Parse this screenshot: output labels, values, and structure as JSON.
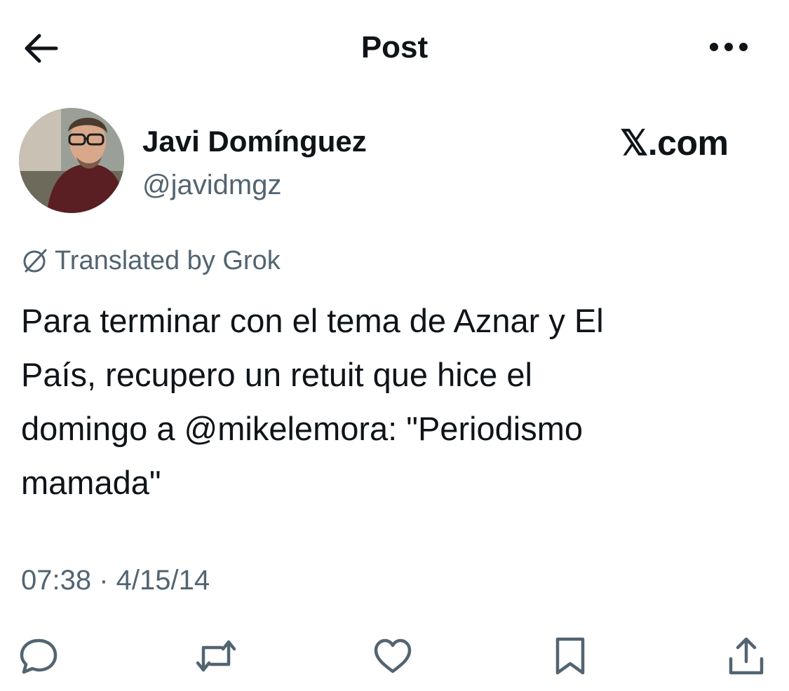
{
  "header": {
    "title": "Post",
    "back_icon": "back-arrow-icon",
    "more_icon": "more-icon"
  },
  "author": {
    "display_name": "Javi Domínguez",
    "handle": "@javidmgz",
    "avatar": "avatar-photo"
  },
  "watermark": "𝕏.com",
  "translation_note": "Translated by Grok",
  "post": {
    "lines": [
      "Para terminar con el tema de Aznar y El",
      "País, recupero un retuit que hice el",
      "domingo a @mikelemora: \"Periodismo",
      "mamada\""
    ]
  },
  "timestamp": "07:38 · 4/15/14",
  "actions": [
    "reply-icon",
    "repost-icon",
    "like-icon",
    "bookmark-icon",
    "share-icon"
  ],
  "colors": {
    "text": "#0f1419",
    "secondary": "#536471"
  }
}
